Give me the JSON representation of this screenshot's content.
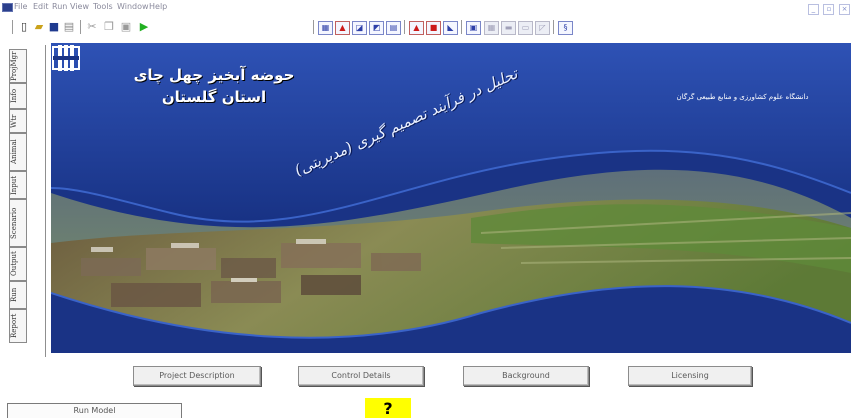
{
  "menubar": {
    "items": [
      "File",
      "Edit",
      "Run",
      "View",
      "Tools",
      "Window",
      "Help"
    ]
  },
  "window_controls": [
    "_",
    "▫",
    "×"
  ],
  "toolbar": {
    "left_icons": [
      "new-file-icon",
      "open-folder-icon",
      "save-icon",
      "print-icon",
      "cut-icon",
      "copy-icon",
      "paste-icon",
      "run-icon"
    ],
    "right_icons": [
      "chart-icon",
      "map-icon",
      "graph-icon",
      "graph2-icon",
      "table-icon",
      "layers-icon",
      "stop-icon",
      "plot-icon",
      "window-icon",
      "grid-icon",
      "bar-icon",
      "disabled-icon",
      "report-icon"
    ]
  },
  "side_tabs": [
    "ProjMgr",
    "Info",
    "Wtr",
    "Animal",
    "Input",
    "Scenario",
    "Output",
    "Run",
    "Report"
  ],
  "banner": {
    "title_line1": "حوضه آبخیز چهل چای",
    "title_line2": "استان گلستان",
    "slogan": "تحلیل در فرآیند تصمیم گیری (مدیریتی)",
    "org_name": "دانشگاه علوم کشاورزی و منابع طبیعی گرگان",
    "colors": {
      "background": "#1a3385",
      "wave": "#1c3a94",
      "wave_edge": "#2c50b0",
      "valley_sky": "#6f8a58"
    }
  },
  "buttons": [
    "Project Description",
    "Control Details",
    "Background",
    "Licensing"
  ],
  "status": {
    "run_model": "Run Model",
    "help": "?"
  }
}
